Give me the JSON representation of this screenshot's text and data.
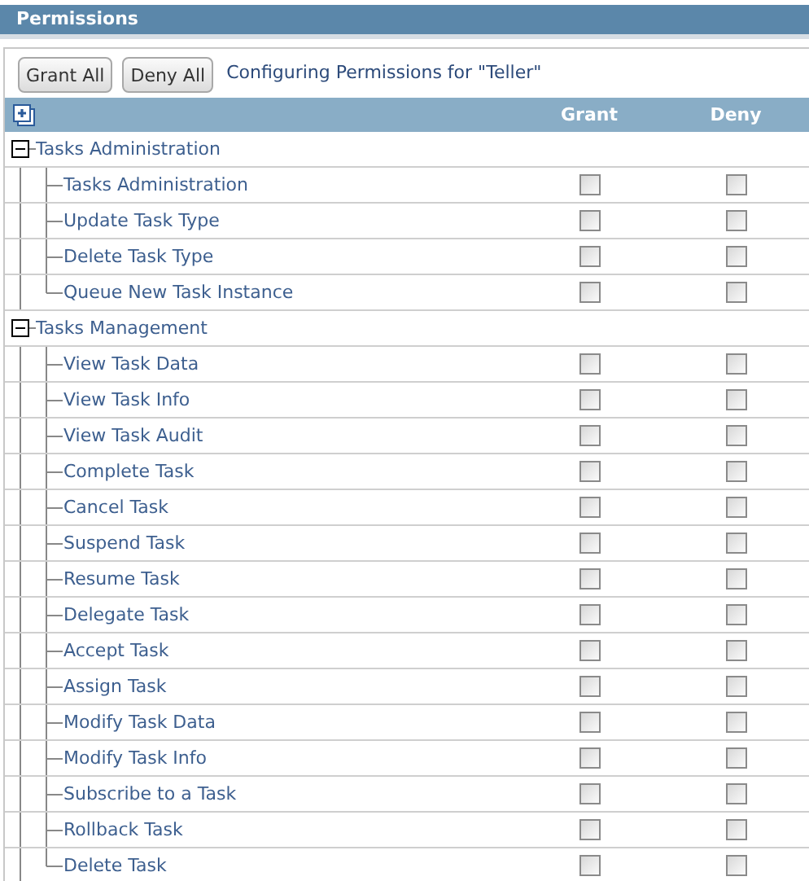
{
  "panel": {
    "title": "Permissions"
  },
  "toolbar": {
    "buttons": [
      "Grant All",
      "Deny All"
    ],
    "caption": "Configuring Permissions for \"Teller\""
  },
  "table": {
    "columns": [
      "Grant",
      "Deny"
    ],
    "groups": [
      {
        "label": "Tasks Administration",
        "expanded": true,
        "children": [
          {
            "label": "Tasks Administration",
            "grant": false,
            "deny": false
          },
          {
            "label": "Update Task Type",
            "grant": false,
            "deny": false
          },
          {
            "label": "Delete Task Type",
            "grant": false,
            "deny": false
          },
          {
            "label": "Queue New Task Instance",
            "grant": false,
            "deny": false
          }
        ]
      },
      {
        "label": "Tasks Management",
        "expanded": true,
        "children": [
          {
            "label": "View Task Data",
            "grant": false,
            "deny": false
          },
          {
            "label": "View Task Info",
            "grant": false,
            "deny": false
          },
          {
            "label": "View Task Audit",
            "grant": false,
            "deny": false
          },
          {
            "label": "Complete Task",
            "grant": false,
            "deny": false
          },
          {
            "label": "Cancel Task",
            "grant": false,
            "deny": false
          },
          {
            "label": "Suspend Task",
            "grant": false,
            "deny": false
          },
          {
            "label": "Resume Task",
            "grant": false,
            "deny": false
          },
          {
            "label": "Delegate Task",
            "grant": false,
            "deny": false
          },
          {
            "label": "Accept Task",
            "grant": false,
            "deny": false
          },
          {
            "label": "Assign Task",
            "grant": false,
            "deny": false
          },
          {
            "label": "Modify Task Data",
            "grant": false,
            "deny": false
          },
          {
            "label": "Modify Task Info",
            "grant": false,
            "deny": false
          },
          {
            "label": "Subscribe to a Task",
            "grant": false,
            "deny": false
          },
          {
            "label": "Rollback Task",
            "grant": false,
            "deny": false
          },
          {
            "label": "Delete Task",
            "grant": false,
            "deny": false
          }
        ]
      }
    ]
  }
}
